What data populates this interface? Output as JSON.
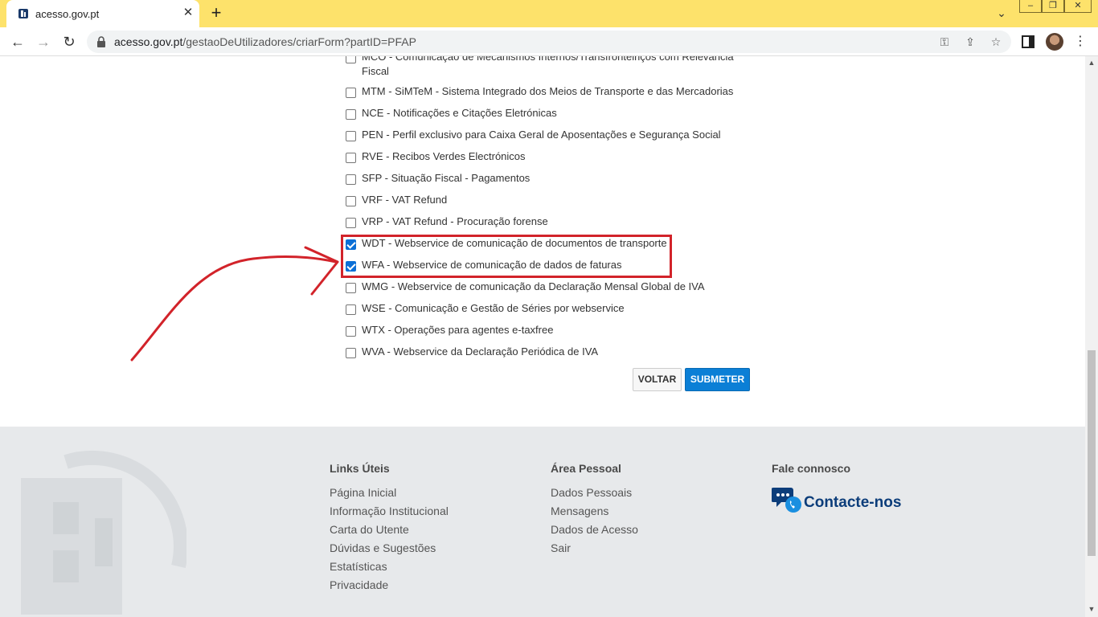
{
  "browser": {
    "tab_title": "acesso.gov.pt",
    "url_host": "acesso.gov.pt",
    "url_path": "/gestaoDeUtilizadores/criarForm?partID=PFAP"
  },
  "form": {
    "items": [
      {
        "label": "MCO - Comunicação de Mecanismos Internos/Transfronteiriços com Relevância",
        "label2": "Fiscal",
        "checked": false
      },
      {
        "label": "MTM - SiMTeM - Sistema Integrado dos Meios de Transporte e das Mercadorias",
        "checked": false
      },
      {
        "label": "NCE - Notificações e Citações Eletrónicas",
        "checked": false
      },
      {
        "label": "PEN - Perfil exclusivo para Caixa Geral de Aposentações e Segurança Social",
        "checked": false
      },
      {
        "label": "RVE - Recibos Verdes Electrónicos",
        "checked": false
      },
      {
        "label": "SFP - Situação Fiscal - Pagamentos",
        "checked": false
      },
      {
        "label": "VRF - VAT Refund",
        "checked": false
      },
      {
        "label": "VRP - VAT Refund - Procuração forense",
        "checked": false
      },
      {
        "label": "WDT - Webservice de comunicação de documentos de transporte",
        "checked": true
      },
      {
        "label": "WFA - Webservice de comunicação de dados de faturas",
        "checked": true
      },
      {
        "label": "WMG - Webservice de comunicação da Declaração Mensal Global de IVA",
        "checked": false
      },
      {
        "label": "WSE - Comunicação e Gestão de Séries por webservice",
        "checked": false
      },
      {
        "label": "WTX - Operações para agentes e-taxfree",
        "checked": false
      },
      {
        "label": "WVA - Webservice da Declaração Periódica de IVA",
        "checked": false
      }
    ],
    "voltar_label": "VOLTAR",
    "submeter_label": "SUBMETER"
  },
  "footer": {
    "links_title": "Links Úteis",
    "links": [
      "Página Inicial",
      "Informação Institucional",
      "Carta do Utente",
      "Dúvidas e Sugestões",
      "Estatísticas",
      "Privacidade"
    ],
    "area_title": "Área Pessoal",
    "area": [
      "Dados Pessoais",
      "Mensagens",
      "Dados de Acesso",
      "Sair"
    ],
    "fale_title": "Fale connosco",
    "contact_label": "Contacte-nos"
  },
  "colors": {
    "tabbar": "#fde26b",
    "accent_blue": "#0b7fd6",
    "annotation_red": "#d2232a",
    "footer_bg": "#e7e9eb",
    "contact_blue": "#0c3d7a"
  },
  "icons": {
    "tab": "portal-favicon-icon",
    "close": "close-icon",
    "new_tab": "plus-icon",
    "back": "arrow-left-icon",
    "forward": "arrow-right-icon",
    "reload": "reload-icon",
    "lock": "lock-icon",
    "key": "key-icon",
    "share": "share-icon",
    "star": "star-icon",
    "contact": "chat-phone-icon"
  }
}
